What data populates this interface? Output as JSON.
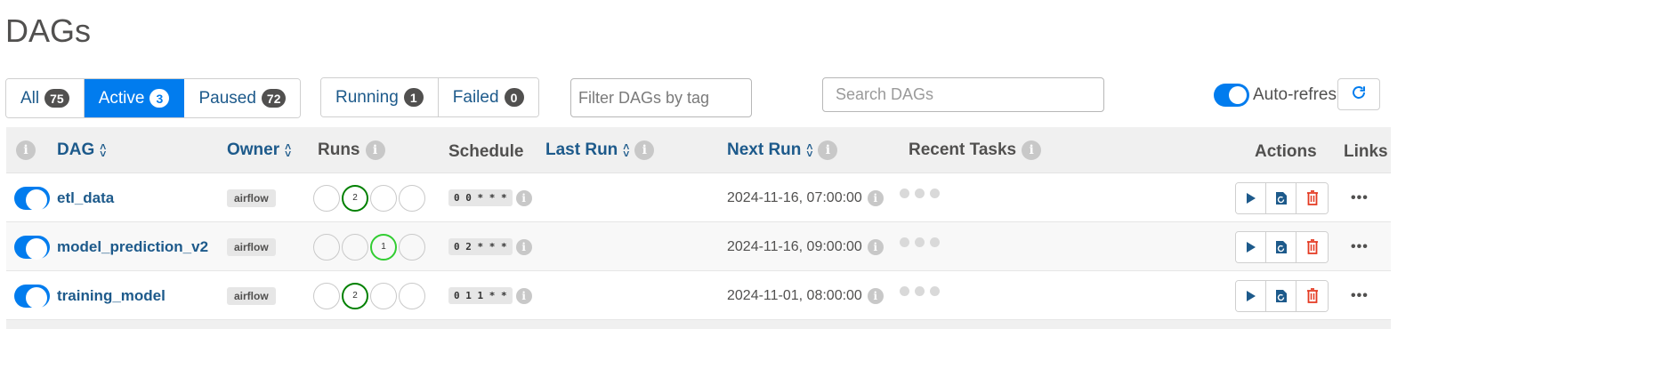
{
  "page": {
    "title": "DAGs"
  },
  "status_filter": {
    "all": {
      "label": "All",
      "count": "75"
    },
    "active": {
      "label": "Active",
      "count": "3"
    },
    "paused": {
      "label": "Paused",
      "count": "72"
    }
  },
  "run_filter": {
    "running": {
      "label": "Running",
      "count": "1"
    },
    "failed": {
      "label": "Failed",
      "count": "0"
    }
  },
  "tag_filter": {
    "placeholder": "Filter DAGs by tag",
    "value": ""
  },
  "search": {
    "placeholder": "Search DAGs",
    "value": ""
  },
  "auto_refresh": {
    "label": "Auto-refresh",
    "enabled": true
  },
  "table": {
    "headers": {
      "dag": "DAG",
      "owner": "Owner",
      "runs": "Runs",
      "schedule": "Schedule",
      "last_run": "Last Run",
      "next_run": "Next Run",
      "recent_tasks": "Recent Tasks",
      "actions": "Actions",
      "links": "Links"
    },
    "rows": [
      {
        "dag_id": "etl_data",
        "owner": "airflow",
        "runs": [
          {
            "count": "",
            "state": "none"
          },
          {
            "count": "2",
            "state": "success"
          },
          {
            "count": "",
            "state": "none"
          },
          {
            "count": "",
            "state": "none"
          }
        ],
        "schedule": "0 0 * * *",
        "last_run": "",
        "next_run": "2024-11-16, 07:00:00"
      },
      {
        "dag_id": "model_prediction_v2",
        "owner": "airflow",
        "runs": [
          {
            "count": "",
            "state": "none"
          },
          {
            "count": "",
            "state": "none"
          },
          {
            "count": "1",
            "state": "running"
          },
          {
            "count": "",
            "state": "none"
          }
        ],
        "schedule": "0 2 * * *",
        "last_run": "",
        "next_run": "2024-11-16, 09:00:00"
      },
      {
        "dag_id": "training_model",
        "owner": "airflow",
        "runs": [
          {
            "count": "",
            "state": "none"
          },
          {
            "count": "2",
            "state": "success"
          },
          {
            "count": "",
            "state": "none"
          },
          {
            "count": "",
            "state": "none"
          }
        ],
        "schedule": "0 1 1 * *",
        "last_run": "",
        "next_run": "2024-11-01, 08:00:00"
      }
    ]
  },
  "colors": {
    "accent": "#017cee",
    "link": "#1d5a8b",
    "success": "#008000",
    "running": "#32cd32",
    "delete": "#e43921"
  },
  "icons": {
    "info": "info-icon",
    "sort": "sort-icon",
    "refresh": "refresh-icon",
    "trigger": "play-icon",
    "clear": "clear-icon",
    "delete": "trash-icon",
    "links": "more-icon"
  }
}
